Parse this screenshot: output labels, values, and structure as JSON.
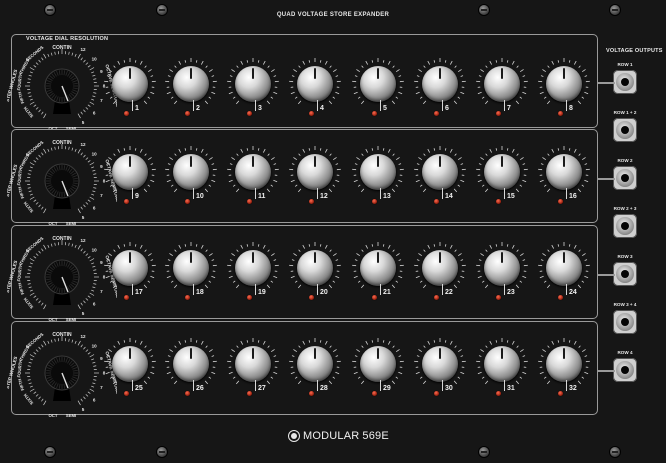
{
  "panel": {
    "title": "QUAD VOLTAGE STORE EXPANDER",
    "resolution_label": "VOLTAGE DIAL RESOLUTION",
    "outputs_label": "VOLTAGE OUTPUTS",
    "brand": "MODULAR",
    "model": "569E"
  },
  "resolution_dial": {
    "top_label": "CONTIN",
    "left_labels": [
      "SECONDS",
      "THIRDS",
      "FOURTH",
      "FIFTH",
      "SIXTH"
    ],
    "side_text_left": "STEP WHOLES",
    "side_text_right": "OCTAVE SEMITONE",
    "right_numbers": [
      "12",
      "10",
      "9",
      "8",
      "7",
      "6",
      "5"
    ],
    "bottom_labels": [
      "OCT",
      "SEMI"
    ]
  },
  "steps": [
    "1",
    "2",
    "3",
    "4",
    "5",
    "6",
    "7",
    "8",
    "9",
    "10",
    "11",
    "12",
    "13",
    "14",
    "15",
    "16",
    "17",
    "18",
    "19",
    "20",
    "21",
    "22",
    "23",
    "24",
    "25",
    "26",
    "27",
    "28",
    "29",
    "30",
    "31",
    "32"
  ],
  "outputs": [
    "ROW 1",
    "ROW 1 + 2",
    "ROW 2",
    "ROW 2 + 3",
    "ROW 3",
    "ROW 3 + 4",
    "ROW 4"
  ],
  "colors": {
    "panel": "#161616",
    "text": "#e8e8e8",
    "led": "#d8301a"
  }
}
